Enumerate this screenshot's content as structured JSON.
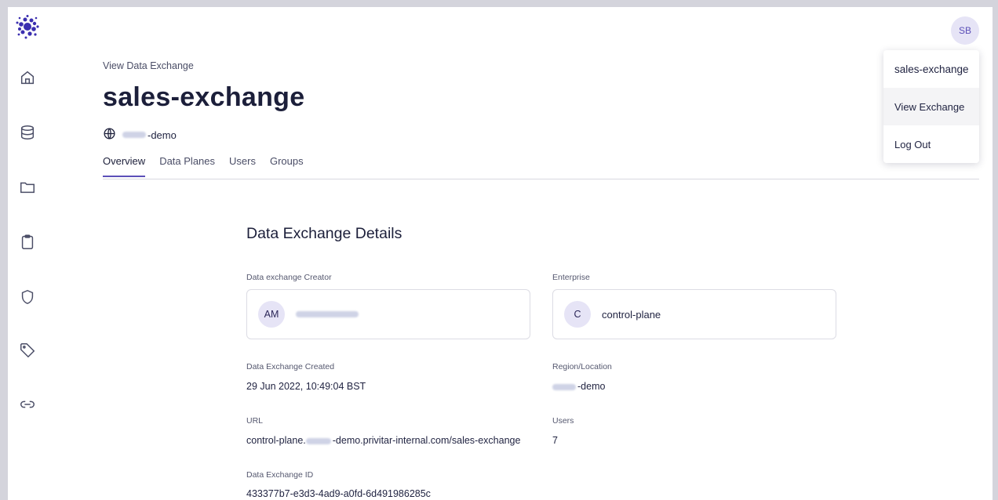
{
  "user": {
    "initials": "SB"
  },
  "menu": {
    "items": [
      "sales-exchange",
      "View Exchange",
      "Log Out"
    ]
  },
  "header": {
    "breadcrumb": "View Data Exchange",
    "title": "sales-exchange",
    "org_suffix": "-demo",
    "tabs": [
      "Overview",
      "Data Planes",
      "Users",
      "Groups"
    ]
  },
  "details": {
    "title": "Data Exchange Details",
    "creator_label": "Data exchange Creator",
    "creator_initials": "AM",
    "enterprise_label": "Enterprise",
    "enterprise_initial": "C",
    "enterprise_name": "control-plane",
    "created_label": "Data Exchange Created",
    "created_value": "29 Jun 2022, 10:49:04 BST",
    "region_label": "Region/Location",
    "region_suffix": "-demo",
    "url_label": "URL",
    "url_prefix": "control-plane.",
    "url_suffix": "-demo.privitar-internal.com/sales-exchange",
    "users_label": "Users",
    "users_value": "7",
    "id_label": "Data Exchange ID",
    "id_value": "433377b7-e3d3-4ad9-a0fd-6d491986285c"
  },
  "colors": {
    "accent": "#5b4fb8",
    "chip_bg": "#e6e4f6",
    "logo": "#3b2fb0"
  },
  "icons": [
    "home-icon",
    "database-icon",
    "folder-icon",
    "clipboard-icon",
    "shield-icon",
    "tag-icon",
    "link-icon",
    "globe-icon"
  ]
}
